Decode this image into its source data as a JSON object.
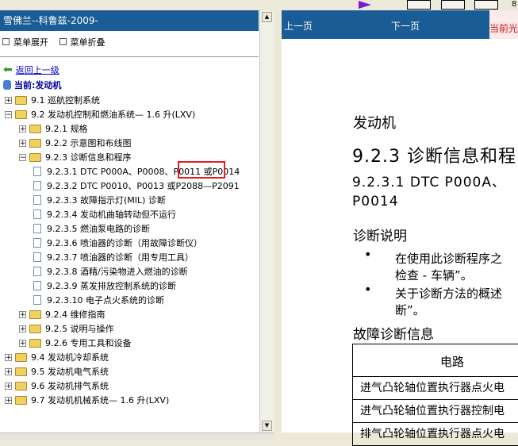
{
  "toolbar": {
    "page_num": "8"
  },
  "left_panel": {
    "title": "雪佛兰--科鲁兹-2009-",
    "expand_label": "菜单展开",
    "collapse_label": "菜单折叠",
    "back_label": "返回上一级",
    "current_label": "当前:发动机"
  },
  "tree": [
    {
      "label": "9.1 巡航控制系统",
      "toggle": "+",
      "kind": "folder"
    },
    {
      "label": "9.2 发动机控制和燃油系统— 1.6 升(LXV)",
      "toggle": "−",
      "kind": "folder"
    },
    {
      "label": "9.2.1 规格",
      "toggle": "+",
      "kind": "folder"
    },
    {
      "label": "9.2.2 示意图和布线图",
      "toggle": "+",
      "kind": "folder"
    },
    {
      "label": "9.2.3 诊断信息和程序",
      "toggle": "−",
      "kind": "folder"
    },
    {
      "label": "9.2.3.1 DTC P000A、P0008、P0011 或P0014",
      "kind": "doc"
    },
    {
      "label": "9.2.3.2 DTC P0010、P0013 或P2088—P2091",
      "kind": "doc"
    },
    {
      "label": "9.2.3.3 故障指示灯(MIL) 诊断",
      "kind": "doc"
    },
    {
      "label": "9.2.3.4 发动机曲轴转动但不运行",
      "kind": "doc"
    },
    {
      "label": "9.2.3.5 燃油泵电路的诊断",
      "kind": "doc"
    },
    {
      "label": "9.2.3.6 喷油器的诊断（用故障诊断仪）",
      "kind": "doc"
    },
    {
      "label": "9.2.3.7 喷油器的诊断（用专用工具）",
      "kind": "doc"
    },
    {
      "label": "9.2.3.8 酒精/污染物进入燃油的诊断",
      "kind": "doc"
    },
    {
      "label": "9.2.3.9 蒸发排放控制系统的诊断",
      "kind": "doc"
    },
    {
      "label": "9.2.3.10 电子点火系统的诊断",
      "kind": "doc"
    },
    {
      "label": "9.2.4 维修指南",
      "toggle": "+",
      "kind": "folder"
    },
    {
      "label": "9.2.5 说明与操作",
      "toggle": "+",
      "kind": "folder"
    },
    {
      "label": "9.2.6 专用工具和设备",
      "toggle": "+",
      "kind": "folder"
    },
    {
      "label": "9.4 发动机冷却系统",
      "toggle": "+",
      "kind": "folder"
    },
    {
      "label": "9.5 发动机电气系统",
      "toggle": "+",
      "kind": "folder"
    },
    {
      "label": "9.6 发动机排气系统",
      "toggle": "+",
      "kind": "folder"
    },
    {
      "label": "9.7 发动机机械系统— 1.6 升(LXV)",
      "toggle": "+",
      "kind": "folder"
    }
  ],
  "right_panel": {
    "prev_label": "上一页",
    "next_label": "下一页",
    "current_label": "当前光",
    "section": "发动机",
    "heading": "9.2.3 诊断信息和程",
    "subheading_line1": "9.2.3.1 DTC P000A、",
    "subheading_line2": "P0014",
    "diag_title": "诊断说明",
    "bullet1_line1": "在使用此诊断程序之",
    "bullet1_line2": "检查 - 车辆”。",
    "bullet2_line1": "关于诊断方法的概述",
    "bullet2_line2": "断”。",
    "fault_title": "故障诊断信息",
    "table_header": "电路",
    "table_rows": [
      "进气凸轮轴位置执行器点火电",
      "进气凸轮轴位置执行器控制电",
      "排气凸轮轴位置执行器点火电"
    ]
  },
  "colors": {
    "title_bar": "#1a5d96",
    "highlight_box": "#e02020",
    "link": "#0000cc"
  }
}
